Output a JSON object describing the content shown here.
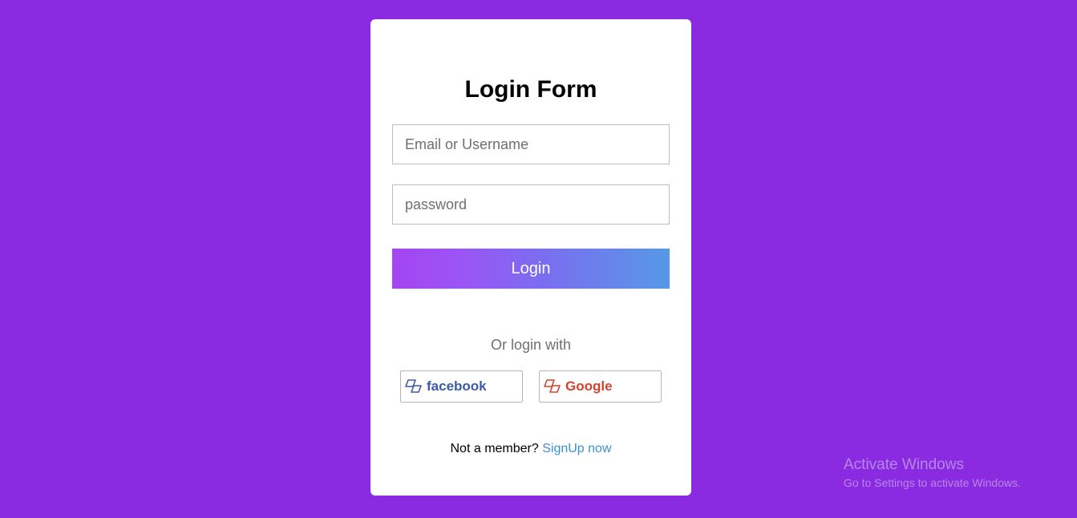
{
  "form": {
    "title": "Login Form",
    "email_placeholder": "Email or Username",
    "password_placeholder": "password",
    "login_label": "Login",
    "or_text": "Or login with",
    "social": {
      "facebook_label": "facebook",
      "facebook_color": "#3b5aa8",
      "google_label": "Google",
      "google_color": "#d3442f"
    },
    "signup_prompt": "Not a member?",
    "signup_link": "SignUp now"
  },
  "colors": {
    "background": "#8a2be2",
    "button_gradient_start": "#a445f3",
    "button_gradient_end": "#5699e6",
    "link": "#3d8fd6"
  },
  "watermark": {
    "title": "Activate Windows",
    "subtitle": "Go to Settings to activate Windows."
  }
}
